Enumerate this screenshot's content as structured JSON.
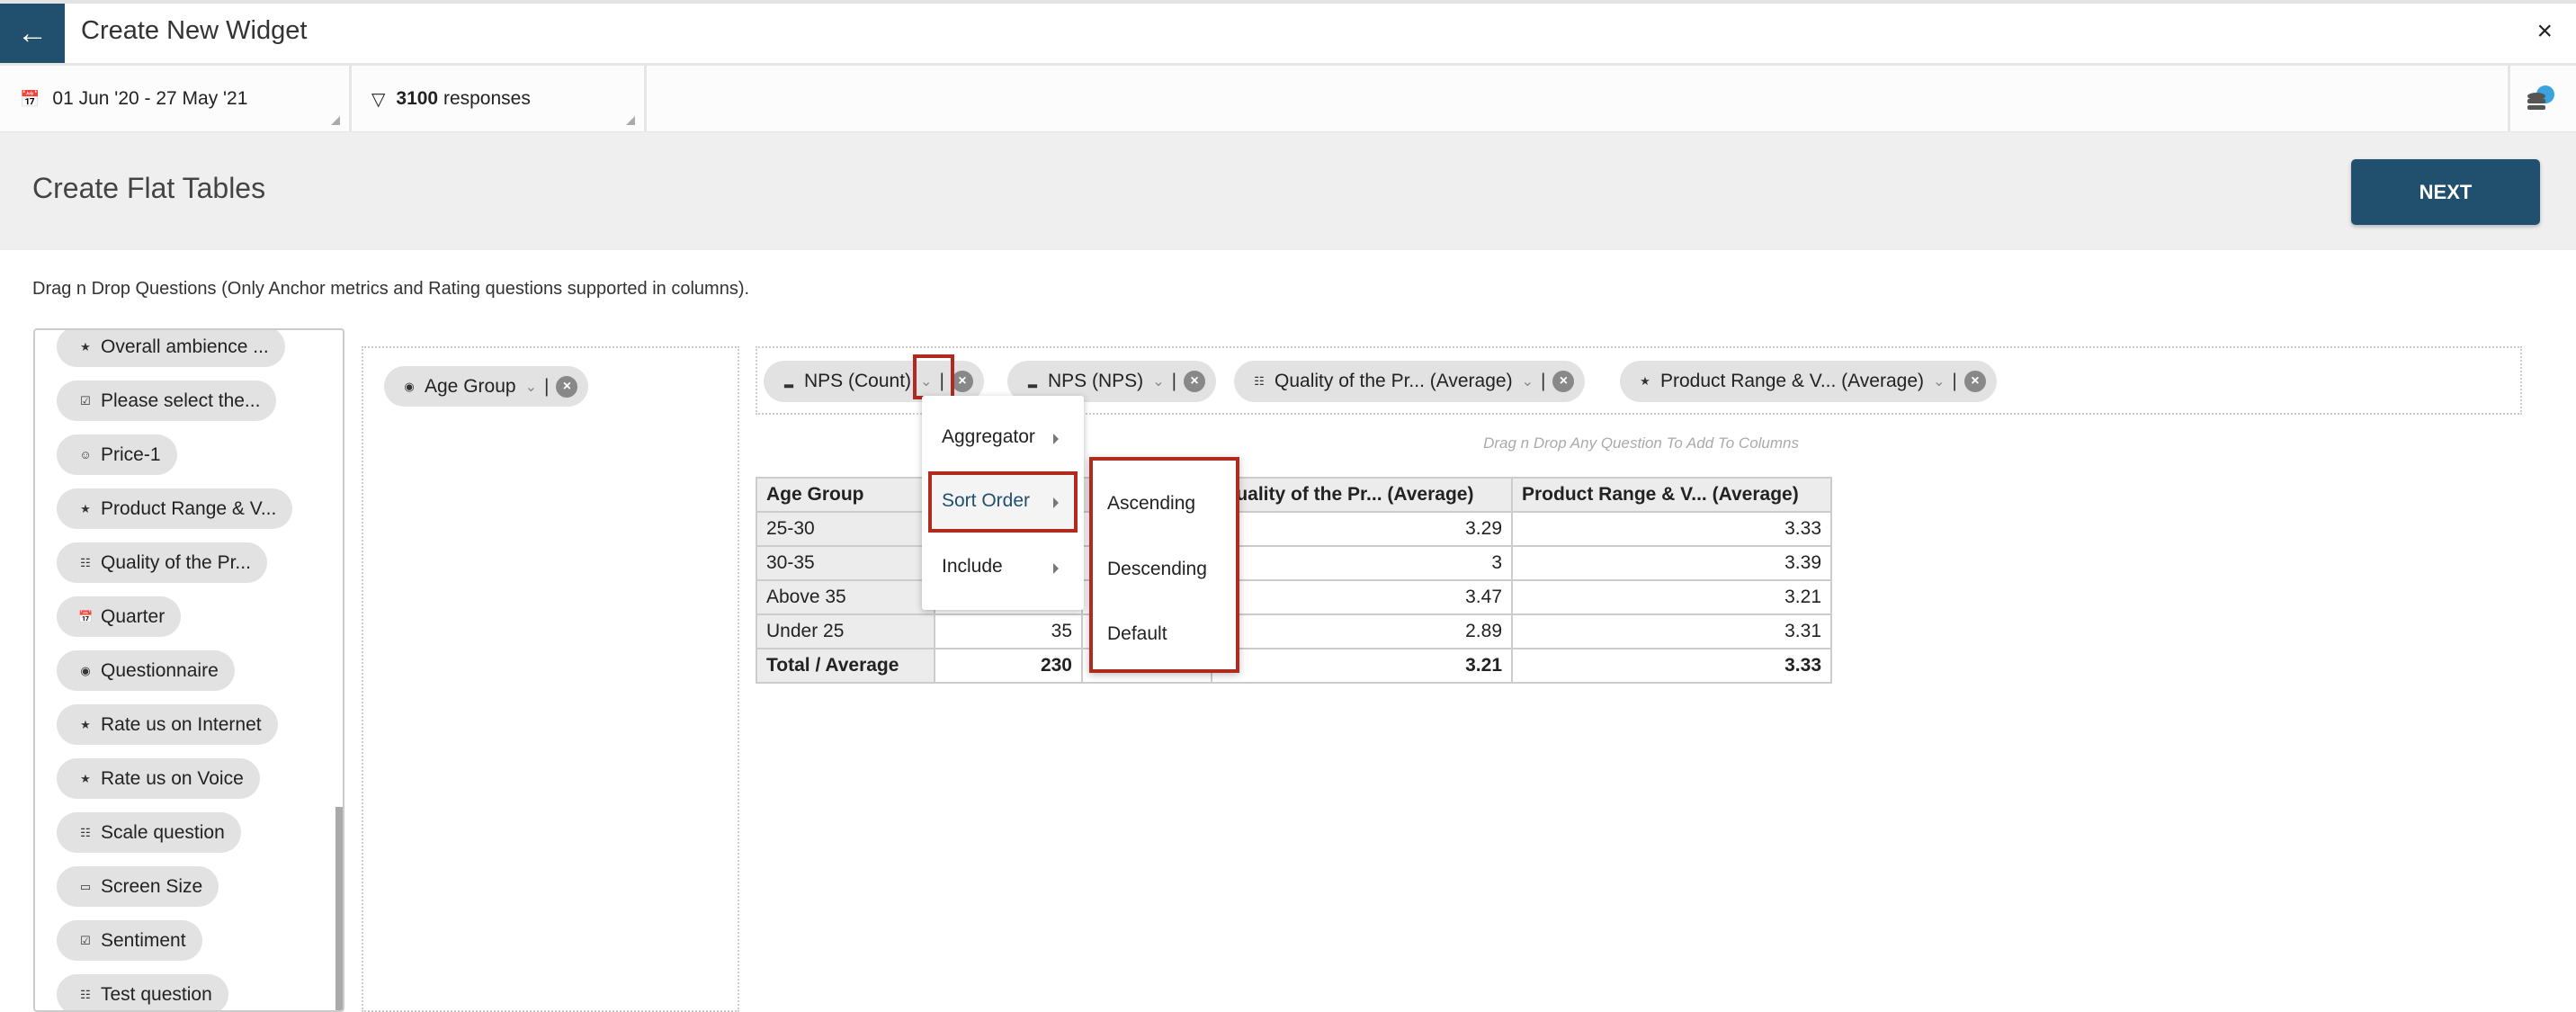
{
  "header": {
    "title": "Create New Widget",
    "back_icon": "arrow-left-icon",
    "close_icon": "close-icon"
  },
  "filters": {
    "date_range": "01 Jun '20 - 27 May '21",
    "responses_count": "3100",
    "responses_label": "responses",
    "data_source_icon": "database-globe-icon"
  },
  "page": {
    "title": "Create Flat Tables",
    "next_label": "NEXT",
    "instruction": "Drag n Drop Questions (Only Anchor metrics and Rating questions supported in columns)."
  },
  "questions": [
    {
      "label": "Overall ambience ...",
      "icon": "star"
    },
    {
      "label": "Please select the...",
      "icon": "checkbox-list"
    },
    {
      "label": "Price-1",
      "icon": "smiley"
    },
    {
      "label": "Product Range & V...",
      "icon": "star"
    },
    {
      "label": "Quality of the Pr...",
      "icon": "scale"
    },
    {
      "label": "Quarter",
      "icon": "calendar"
    },
    {
      "label": "Questionnaire",
      "icon": "radio"
    },
    {
      "label": "Rate us on Internet",
      "icon": "star"
    },
    {
      "label": "Rate us on Voice",
      "icon": "star"
    },
    {
      "label": "Scale question",
      "icon": "scale"
    },
    {
      "label": "Screen Size",
      "icon": "text-field"
    },
    {
      "label": "Sentiment",
      "icon": "checkbox-list"
    },
    {
      "label": "Test question",
      "icon": "scale"
    }
  ],
  "rows": {
    "chips": [
      {
        "label": "Age Group",
        "icon": "radio"
      }
    ]
  },
  "columns": {
    "chips": [
      {
        "label": "NPS (Count)",
        "icon": "nps"
      },
      {
        "label": "NPS (NPS)",
        "icon": "nps"
      },
      {
        "label": "Quality of the Pr... (Average)",
        "icon": "scale"
      },
      {
        "label": "Product Range & V... (Average)",
        "icon": "star"
      }
    ],
    "hint": "Drag n Drop Any Question To Add To Columns"
  },
  "table": {
    "headers": [
      "Age Group",
      "",
      "",
      "Quality of the Pr... (Average)",
      "Product Range & V... (Average)"
    ],
    "rows": [
      [
        "25-30",
        "",
        "",
        "3.29",
        "3.33"
      ],
      [
        "30-35",
        "",
        "",
        "3",
        "3.39"
      ],
      [
        "Above 35",
        "",
        "",
        "3.47",
        "3.21"
      ],
      [
        "Under 25",
        "35",
        "",
        "2.89",
        "3.31"
      ]
    ],
    "total": [
      "Total / Average",
      "230",
      "",
      "3.21",
      "3.33"
    ]
  },
  "menu": {
    "items": [
      "Aggregator",
      "Sort Order",
      "Include"
    ],
    "active": "Sort Order",
    "active_color": "#21506f"
  },
  "submenu": {
    "items": [
      "Ascending",
      "Descending",
      "Default"
    ]
  },
  "colors": {
    "brand": "#21506f",
    "highlight": "#b02a1e"
  }
}
